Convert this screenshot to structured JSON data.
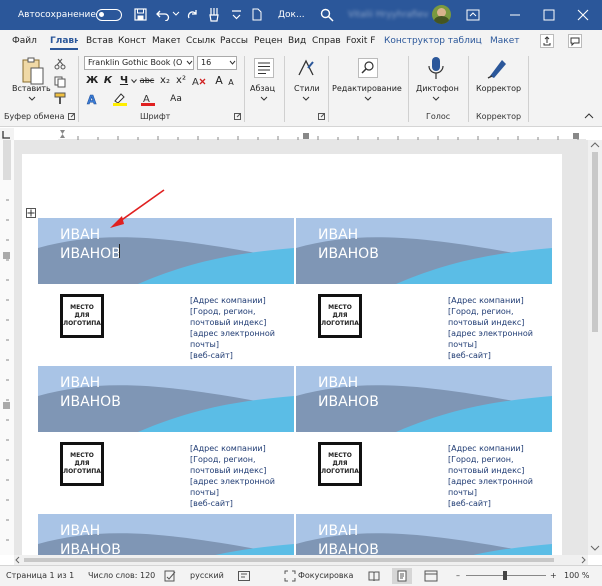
{
  "titlebar": {
    "autosave_label": "Автосохранение",
    "doc_title": "Док...",
    "user_name": "Vitalii Hryyhrafiev"
  },
  "tabs": [
    "Файл",
    "Главн",
    "Встав",
    "Конст",
    "Макет",
    "Ссылк",
    "Рассы",
    "Рецен",
    "Вид",
    "Справ",
    "Foxit F",
    "Конструктор таблиц",
    "Макет"
  ],
  "ribbon": {
    "paste_label": "Вставить",
    "font_name": "Franklin Gothic Book (O",
    "font_size": "16",
    "paragraph_label": "Абзац",
    "styles_label": "Стили",
    "editing_label": "Редактирование",
    "dictate_label": "Диктофон",
    "editor_label": "Корректор",
    "groups": {
      "clipboard": "Буфер обмена",
      "font": "Шрифт",
      "voice": "Голос",
      "editor": "Корректор"
    },
    "format_glyphs": {
      "bold": "Ж",
      "italic": "К",
      "underline": "Ч",
      "strike": "abc",
      "subscript": "x₂",
      "superscript": "x²",
      "grow": "A",
      "shrink": "A",
      "case": "Aa"
    }
  },
  "cards": [
    {
      "name": "ИВАН\nИВАНОВ",
      "logo": "МЕСТО\nДЛЯ\nЛОГОТИПА",
      "address": [
        "[Адрес компании]",
        "[Город, регион, почтовый индекс]",
        "[адрес электронной почты]",
        "[веб-сайт]"
      ]
    },
    {
      "name": "ИВАН\nИВАНОВ",
      "logo": "МЕСТО\nДЛЯ\nЛОГОТИПА",
      "address": [
        "[Адрес компании]",
        "[Город, регион, почтовый индекс]",
        "[адрес электронной почты]",
        "[веб-сайт]"
      ]
    },
    {
      "name": "ИВАН\nИВАНОВ",
      "logo": "МЕСТО\nДЛЯ\nЛОГОТИПА",
      "address": [
        "[Адрес компании]",
        "[Город, регион, почтовый индекс]",
        "[адрес электронной почты]",
        "[веб-сайт]"
      ]
    },
    {
      "name": "ИВАН\nИВАНОВ",
      "logo": "МЕСТО\nДЛЯ\nЛОГОТИПА",
      "address": [
        "[Адрес компании]",
        "[Город, регион, почтовый индекс]",
        "[адрес электронной почты]",
        "[веб-сайт]"
      ]
    },
    {
      "name": "ИВАН\nИВАНОВ"
    },
    {
      "name": "ИВАН\nИВАНОВ"
    }
  ],
  "status": {
    "page": "Страница 1 из 1",
    "words": "Число слов: 120",
    "language": "русский",
    "focus": "Фокусировка",
    "zoom": "100 %"
  },
  "colors": {
    "brand": "#2b579a",
    "card_band": "#a9c4e6",
    "wave_dark": "#7f96b5",
    "wave_light": "#5bbde6",
    "arrow": "#e02020"
  }
}
